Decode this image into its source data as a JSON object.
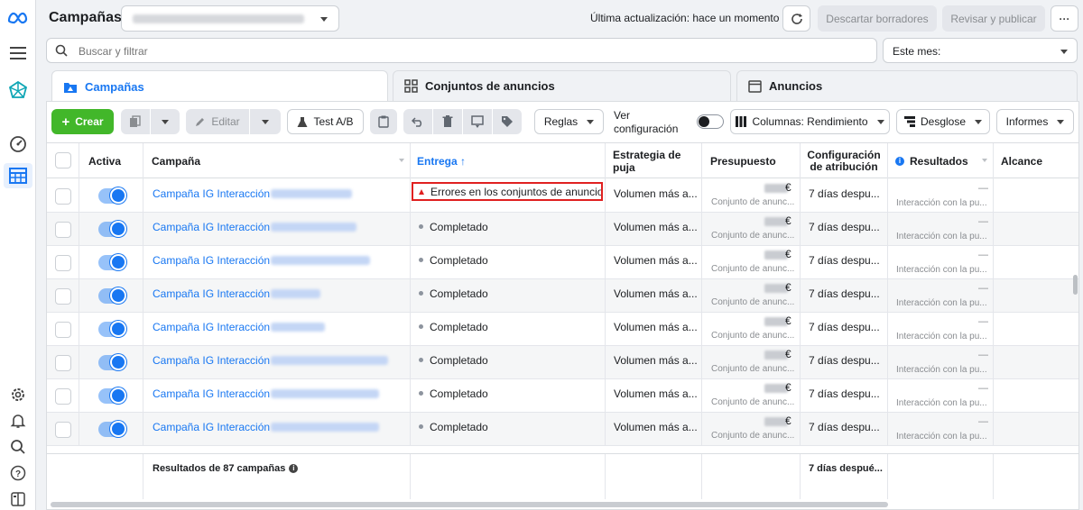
{
  "header": {
    "title": "Campañas",
    "last_update": "Última actualización: hace un momento",
    "discard_label": "Descartar borradores",
    "publish_label": "Revisar y publicar",
    "more_label": "···"
  },
  "search": {
    "placeholder": "Buscar y filtrar"
  },
  "date_filter": {
    "label": "Este mes:"
  },
  "tabs": [
    {
      "label": "Campañas",
      "active": true
    },
    {
      "label": "Conjuntos de anuncios",
      "active": false
    },
    {
      "label": "Anuncios",
      "active": false
    }
  ],
  "toolbar": {
    "create_label": "Crear",
    "edit_label": "Editar",
    "ab_test_label": "Test A/B",
    "rules_label": "Reglas",
    "view_config_label_1": "Ver",
    "view_config_label_2": "configuración",
    "columns_label": "Columnas: Rendimiento",
    "breakdown_label": "Desglose",
    "reports_label": "Informes"
  },
  "table": {
    "columns": {
      "active": "Activa",
      "campaign": "Campaña",
      "delivery": "Entrega ↑",
      "bid_strategy": "Estrategia de puja",
      "budget": "Presupuesto",
      "attribution_1": "Configuración",
      "attribution_2": "de atribución",
      "results": "Resultados",
      "reach": "Alcance"
    },
    "rows": [
      {
        "name": "Campaña IG Interacción -",
        "delivery": "Errores en los conjuntos de anuncios",
        "error": true,
        "bid": "Volumen más a...",
        "currency": "€",
        "budget_sub": "Conjunto de anunc...",
        "attribution": "7 días despu...",
        "result": "—",
        "result_sub": "Interacción con la pu..."
      },
      {
        "name": "Campaña IG Interacción -",
        "delivery": "Completado",
        "error": false,
        "bid": "Volumen más a...",
        "currency": "€",
        "budget_sub": "Conjunto de anunc...",
        "attribution": "7 días despu...",
        "result": "—",
        "result_sub": "Interacción con la pu..."
      },
      {
        "name": "Campaña IG Interacción -",
        "delivery": "Completado",
        "error": false,
        "bid": "Volumen más a...",
        "currency": "€",
        "budget_sub": "Conjunto de anunc...",
        "attribution": "7 días despu...",
        "result": "—",
        "result_sub": "Interacción con la pu..."
      },
      {
        "name": "Campaña IG Interacción -",
        "delivery": "Completado",
        "error": false,
        "bid": "Volumen más a...",
        "currency": "€",
        "budget_sub": "Conjunto de anunc...",
        "attribution": "7 días despu...",
        "result": "—",
        "result_sub": "Interacción con la pu..."
      },
      {
        "name": "Campaña IG Interacción -",
        "delivery": "Completado",
        "error": false,
        "bid": "Volumen más a...",
        "currency": "€",
        "budget_sub": "Conjunto de anunc...",
        "attribution": "7 días despu...",
        "result": "—",
        "result_sub": "Interacción con la pu..."
      },
      {
        "name": "Campaña IG Interacción -",
        "delivery": "Completado",
        "error": false,
        "bid": "Volumen más a...",
        "currency": "€",
        "budget_sub": "Conjunto de anunc...",
        "attribution": "7 días despu...",
        "result": "—",
        "result_sub": "Interacción con la pu..."
      },
      {
        "name": "Campaña IG Interacción -",
        "delivery": "Completado",
        "error": false,
        "bid": "Volumen más a...",
        "currency": "€",
        "budget_sub": "Conjunto de anunc...",
        "attribution": "7 días despu...",
        "result": "—",
        "result_sub": "Interacción con la pu..."
      },
      {
        "name": "Campaña IG Interacción -",
        "delivery": "Completado",
        "error": false,
        "bid": "Volumen más a...",
        "currency": "€",
        "budget_sub": "Conjunto de anunc...",
        "attribution": "7 días despu...",
        "result": "—",
        "result_sub": "Interacción con la pu..."
      }
    ],
    "footer": {
      "results_label": "Resultados de 87 campañas",
      "attribution": "7 días despué..."
    }
  },
  "colors": {
    "accent": "#1877f2",
    "create": "#42b72a",
    "error": "#e02020"
  },
  "icons": [
    "meta-logo-icon",
    "menu-icon",
    "campaign-network-icon",
    "gauge-icon",
    "table-grid-icon",
    "gear-icon",
    "bell-icon",
    "search-icon",
    "help-icon",
    "panel-toggle-icon"
  ]
}
